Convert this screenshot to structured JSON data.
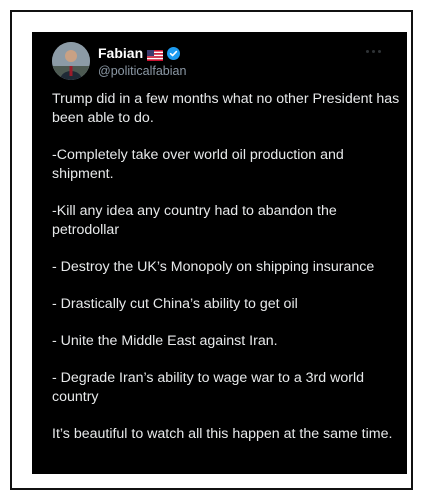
{
  "tweet": {
    "author": {
      "display_name": "Fabian",
      "flag": "us-flag-icon",
      "verified": "verified-badge-icon",
      "handle": "@politicalfabian"
    },
    "paragraphs": [
      "Trump did in a few months what no other President has been able to do.",
      "-Completely take over world oil production and shipment.",
      "-Kill any idea any country had to abandon the petrodollar",
      "- Destroy the UK’s Monopoly on shipping insurance",
      "- Drastically cut China’s ability to get oil",
      "- Unite the Middle East against Iran.",
      "- Degrade Iran’s ability to wage war to a 3rd world country",
      "It’s beautiful to watch all this happen at the same time."
    ]
  },
  "colors": {
    "card_background": "#000000",
    "text": "#e7e9ea",
    "handle": "#8b98a5",
    "verified": "#1d9bf0"
  }
}
